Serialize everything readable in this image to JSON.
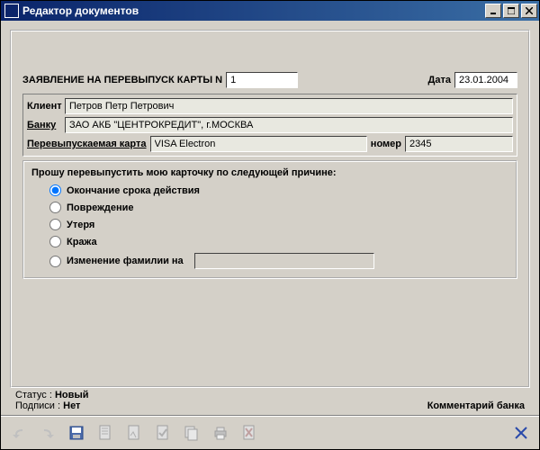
{
  "window": {
    "title": "Редактор документов"
  },
  "form": {
    "heading": "ЗАЯВЛЕНИЕ НА ПЕРЕВЫПУСК КАРТЫ N",
    "number": "1",
    "date_label": "Дата",
    "date_value": "23.01.2004",
    "client_label": "Клиент",
    "client_value": "Петров Петр Петрович",
    "bank_label": "Банку",
    "bank_value": "ЗАО АКБ \"ЦЕНТРОКРЕДИТ\", г.МОСКВА",
    "card_label": "Перевыпускаемая карта",
    "card_value": "VISA Electron",
    "cardnum_label": "номер",
    "cardnum_value": "2345"
  },
  "reason": {
    "caption": "Прошу перевыпустить мою карточку по следующей причине:",
    "opt_expiry": "Окончание срока действия",
    "opt_damage": "Повреждение",
    "opt_lost": "Утеря",
    "opt_theft": "Кража",
    "opt_name": "Изменение фамилии на",
    "name_value": ""
  },
  "status": {
    "status_label": "Статус :",
    "status_value": "Новый",
    "sign_label": "Подписи :",
    "sign_value": "Нет",
    "comment_label": "Комментарий банка"
  }
}
